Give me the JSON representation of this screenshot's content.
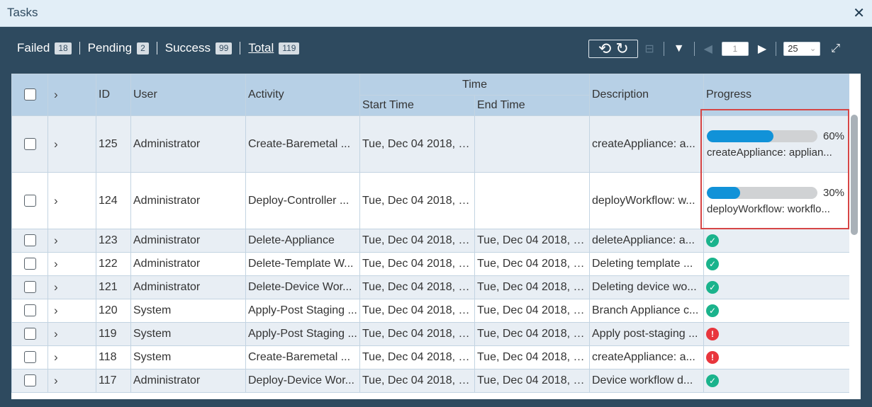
{
  "window": {
    "title": "Tasks"
  },
  "stats": [
    {
      "label": "Failed",
      "count": "18"
    },
    {
      "label": "Pending",
      "count": "2"
    },
    {
      "label": "Success",
      "count": "99"
    },
    {
      "label": "Total",
      "count": "119"
    }
  ],
  "pagination": {
    "page": "1",
    "page_size": "25"
  },
  "columns": {
    "id": "ID",
    "user": "User",
    "activity": "Activity",
    "time_group": "Time",
    "start_time": "Start Time",
    "end_time": "End Time",
    "description": "Description",
    "progress": "Progress"
  },
  "rows": [
    {
      "id": "125",
      "user": "Administrator",
      "activity": "Create-Baremetal ...",
      "start": "Tue, Dec 04 2018, 1...",
      "end": "",
      "description": "createAppliance: a...",
      "progress_pct": 60,
      "progress_label": "60%",
      "progress_desc": "createAppliance: applian..."
    },
    {
      "id": "124",
      "user": "Administrator",
      "activity": "Deploy-Controller ...",
      "start": "Tue, Dec 04 2018, 1...",
      "end": "",
      "description": "deployWorkflow: w...",
      "progress_pct": 30,
      "progress_label": "30%",
      "progress_desc": "deployWorkflow: workflo..."
    },
    {
      "id": "123",
      "user": "Administrator",
      "activity": "Delete-Appliance",
      "start": "Tue, Dec 04 2018, 1...",
      "end": "Tue, Dec 04 2018, 1...",
      "description": "deleteAppliance: a...",
      "status": "success"
    },
    {
      "id": "122",
      "user": "Administrator",
      "activity": "Delete-Template W...",
      "start": "Tue, Dec 04 2018, 1...",
      "end": "Tue, Dec 04 2018, 1...",
      "description": "Deleting template ...",
      "status": "success"
    },
    {
      "id": "121",
      "user": "Administrator",
      "activity": "Delete-Device Wor...",
      "start": "Tue, Dec 04 2018, 1...",
      "end": "Tue, Dec 04 2018, 1...",
      "description": "Deleting device wo...",
      "status": "success"
    },
    {
      "id": "120",
      "user": "System",
      "activity": "Apply-Post Staging ...",
      "start": "Tue, Dec 04 2018, 0...",
      "end": "Tue, Dec 04 2018, 0...",
      "description": "Branch Appliance c...",
      "status": "success"
    },
    {
      "id": "119",
      "user": "System",
      "activity": "Apply-Post Staging ...",
      "start": "Tue, Dec 04 2018, 0...",
      "end": "Tue, Dec 04 2018, 0...",
      "description": "Apply post-staging ...",
      "status": "failed"
    },
    {
      "id": "118",
      "user": "System",
      "activity": "Create-Baremetal ...",
      "start": "Tue, Dec 04 2018, 0...",
      "end": "Tue, Dec 04 2018, 0...",
      "description": "createAppliance: a...",
      "status": "failed"
    },
    {
      "id": "117",
      "user": "Administrator",
      "activity": "Deploy-Device Wor...",
      "start": "Tue, Dec 04 2018, 0...",
      "end": "Tue, Dec 04 2018, 0...",
      "description": "Device workflow d...",
      "status": "success"
    }
  ],
  "icons": {
    "success": "check-circle-icon",
    "failed": "exclamation-circle-icon"
  },
  "colors": {
    "header_bg": "#b7d0e6",
    "panel_bg": "#2e4a5f",
    "progress_fill": "#1192d8",
    "success": "#1ab38c",
    "failed": "#e8363d",
    "highlight": "#d64545"
  }
}
